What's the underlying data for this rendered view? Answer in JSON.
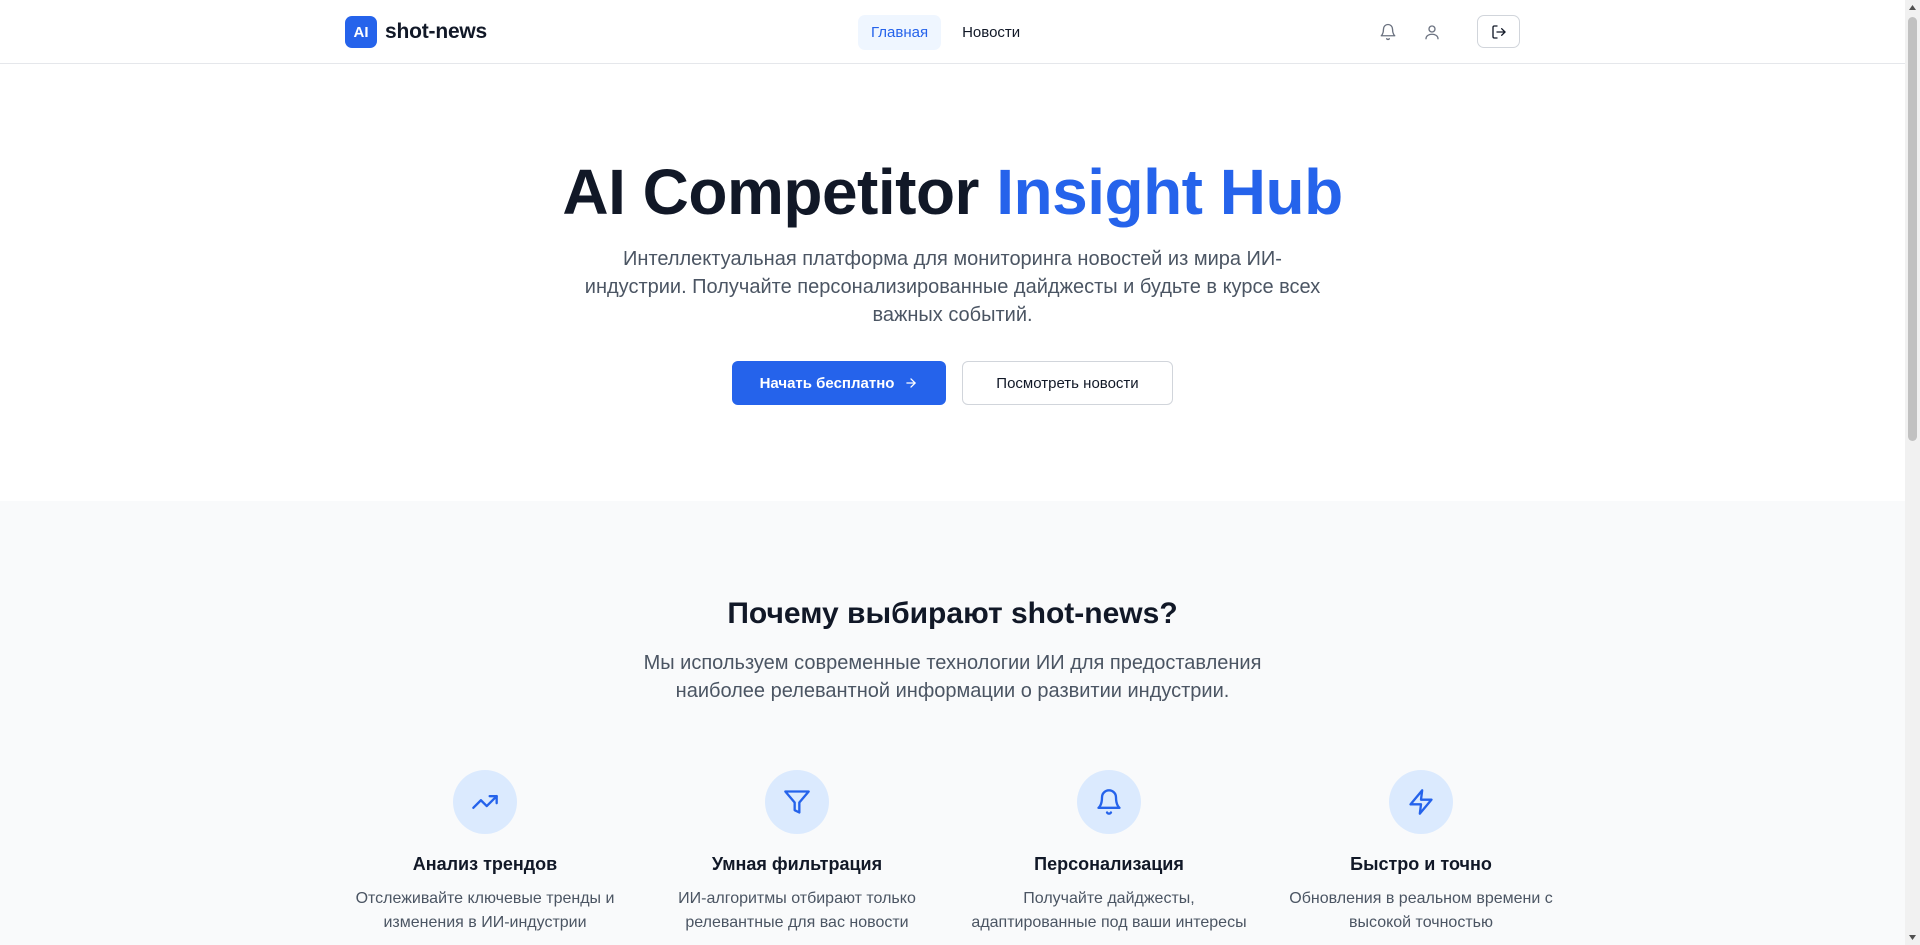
{
  "header": {
    "logo_badge": "AI",
    "logo_text": "shot-news",
    "nav": [
      {
        "label": "Главная",
        "active": true
      },
      {
        "label": "Новости",
        "active": false
      }
    ],
    "icons": [
      "bell-icon",
      "user-icon",
      "logout-icon"
    ]
  },
  "hero": {
    "title_main": "AI Competitor ",
    "title_accent": "Insight Hub",
    "subtitle": "Интеллектуальная платформа для мониторинга новостей из мира ИИ-индустрии. Получайте персонализированные дайджесты и будьте в курсе всех важных событий.",
    "primary_button": "Начать бесплатно",
    "secondary_button": "Посмотреть новости"
  },
  "features": {
    "title": "Почему выбирают shot-news?",
    "subtitle": "Мы используем современные технологии ИИ для предоставления наиболее релевантной информации о развитии индустрии.",
    "items": [
      {
        "icon": "trending-up-icon",
        "title": "Анализ трендов",
        "desc": "Отслеживайте ключевые тренды и изменения в ИИ-индустрии"
      },
      {
        "icon": "filter-icon",
        "title": "Умная фильтрация",
        "desc": "ИИ-алгоритмы отбирают только релевантные для вас новости"
      },
      {
        "icon": "bell-icon",
        "title": "Персонализация",
        "desc": "Получайте дайджесты, адаптированные под ваши интересы"
      },
      {
        "icon": "zap-icon",
        "title": "Быстро и точно",
        "desc": "Обновления в реальном времени с высокой точностью"
      }
    ]
  },
  "colors": {
    "accent": "#2563eb",
    "accent_light": "#dbeafe",
    "text": "#111827",
    "muted": "#4b5563",
    "section_bg": "#f9fafb"
  }
}
